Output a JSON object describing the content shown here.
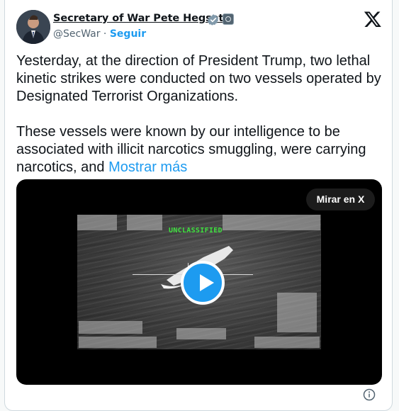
{
  "author": {
    "name": "Secretary of War Pete Hegseth",
    "handle": "@SecWar",
    "separator": " · ",
    "follow_label": "Seguir"
  },
  "icons": {
    "verified": "verified-badge-icon",
    "affiliation": "affiliation-badge-icon",
    "brand": "x-logo-icon",
    "play": "play-icon",
    "info": "info-icon"
  },
  "tweet": {
    "paragraph1": "Yesterday, at the direction of President Trump, two lethal kinetic strikes were conducted on two vessels operated by Designated Terrorist Organizations.",
    "paragraph2": "These vessels were known by our intelligence to be associated with illicit narcotics smuggling, were carrying narcotics, and ",
    "show_more": "Mostrar más"
  },
  "media": {
    "watch_label": "Mirar en X",
    "overlay_text": "UNCLASSIFIED"
  },
  "colors": {
    "accent": "#1d9bf0",
    "text": "#0f1419",
    "muted": "#536471",
    "unclassified_green": "#3fe03f"
  }
}
